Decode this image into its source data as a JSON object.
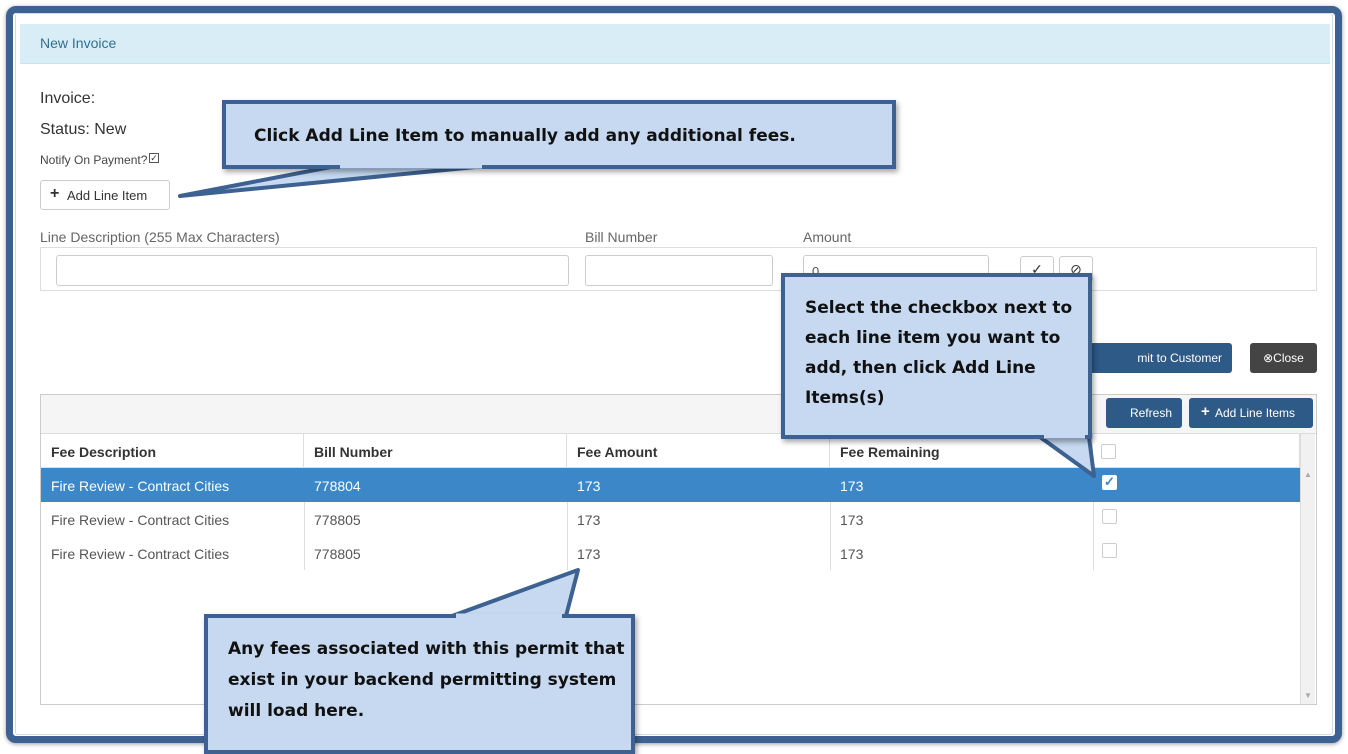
{
  "panel": {
    "title": "New Invoice"
  },
  "invoice": {
    "invoice_label": "Invoice:",
    "status_label": "Status: New",
    "notify_label": "Notify On Payment?",
    "notify_checked": true,
    "add_line_item_label": "Add Line Item"
  },
  "line_form": {
    "desc_label": "Line Description (255 Max Characters)",
    "bill_label": "Bill Number",
    "amount_label": "Amount",
    "desc_value": "",
    "bill_value": "",
    "amount_value": "0"
  },
  "actions": {
    "submit_label": "mit to Customer",
    "close_label": "⊗Close"
  },
  "grid": {
    "refresh_label": "Refresh",
    "add_line_items_label": "Add Line Items",
    "columns": [
      "Fee Description",
      "Bill Number",
      "Fee Amount",
      "Fee Remaining"
    ],
    "rows": [
      {
        "desc": "Fire Review - Contract Cities",
        "bill": "778804",
        "amount": "173",
        "remaining": "173",
        "checked": true,
        "selected": true
      },
      {
        "desc": "Fire Review - Contract Cities",
        "bill": "778805",
        "amount": "173",
        "remaining": "173",
        "checked": false,
        "selected": false
      },
      {
        "desc": "Fire Review - Contract Cities",
        "bill": "778805",
        "amount": "173",
        "remaining": "173",
        "checked": false,
        "selected": false
      }
    ]
  },
  "callouts": {
    "add_line": "Click Add Line Item to manually add any additional fees.",
    "checkbox": "Select the checkbox next to each line item you want to add, then click Add Line Items(s)",
    "fees": "Any fees associated with this permit that exist in your backend permitting system will load here."
  },
  "colors": {
    "frame": "#3d6190",
    "header_bg": "#d9edf7",
    "selected_row": "#3b87c7",
    "primary_btn": "#2e5a87",
    "callout_bg": "#c6d9f1"
  }
}
